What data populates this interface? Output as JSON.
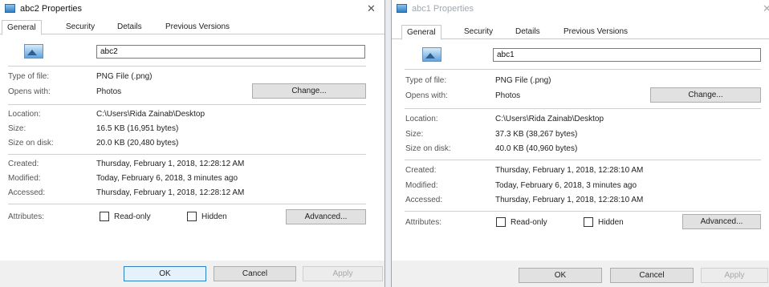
{
  "dialogs": [
    {
      "title": "abc2 Properties",
      "close_symbol": "✕",
      "tabs": [
        "General",
        "Security",
        "Details",
        "Previous Versions"
      ],
      "file_name": "abc2",
      "type_label": "Type of file:",
      "type_value": "PNG File (.png)",
      "opens_label": "Opens with:",
      "opens_value": "Photos",
      "change_label": "Change...",
      "location_label": "Location:",
      "location_value": "C:\\Users\\Rida Zainab\\Desktop",
      "size_label": "Size:",
      "size_value": "16.5 KB (16,951 bytes)",
      "size_disk_label": "Size on disk:",
      "size_disk_value": "20.0 KB (20,480 bytes)",
      "created_label": "Created:",
      "created_value": "Thursday, February 1, 2018, 12:28:12 AM",
      "modified_label": "Modified:",
      "modified_value": "Today, February 6, 2018, 3 minutes ago",
      "accessed_label": "Accessed:",
      "accessed_value": "Thursday, February 1, 2018, 12:28:12 AM",
      "attributes_label": "Attributes:",
      "readonly_label": "Read-only",
      "hidden_label": "Hidden",
      "advanced_label": "Advanced...",
      "ok_label": "OK",
      "cancel_label": "Cancel",
      "apply_label": "Apply"
    },
    {
      "title": "abc1 Properties",
      "close_symbol": "✕",
      "tabs": [
        "General",
        "Security",
        "Details",
        "Previous Versions"
      ],
      "file_name": "abc1",
      "type_label": "Type of file:",
      "type_value": "PNG File (.png)",
      "opens_label": "Opens with:",
      "opens_value": "Photos",
      "change_label": "Change...",
      "location_label": "Location:",
      "location_value": "C:\\Users\\Rida Zainab\\Desktop",
      "size_label": "Size:",
      "size_value": "37.3 KB (38,267 bytes)",
      "size_disk_label": "Size on disk:",
      "size_disk_value": "40.0 KB (40,960 bytes)",
      "created_label": "Created:",
      "created_value": "Thursday, February 1, 2018, 12:28:10 AM",
      "modified_label": "Modified:",
      "modified_value": "Today, February 6, 2018, 3 minutes ago",
      "accessed_label": "Accessed:",
      "accessed_value": "Thursday, February 1, 2018, 12:28:10 AM",
      "attributes_label": "Attributes:",
      "readonly_label": "Read-only",
      "hidden_label": "Hidden",
      "advanced_label": "Advanced...",
      "ok_label": "OK",
      "cancel_label": "Cancel",
      "apply_label": "Apply"
    }
  ]
}
